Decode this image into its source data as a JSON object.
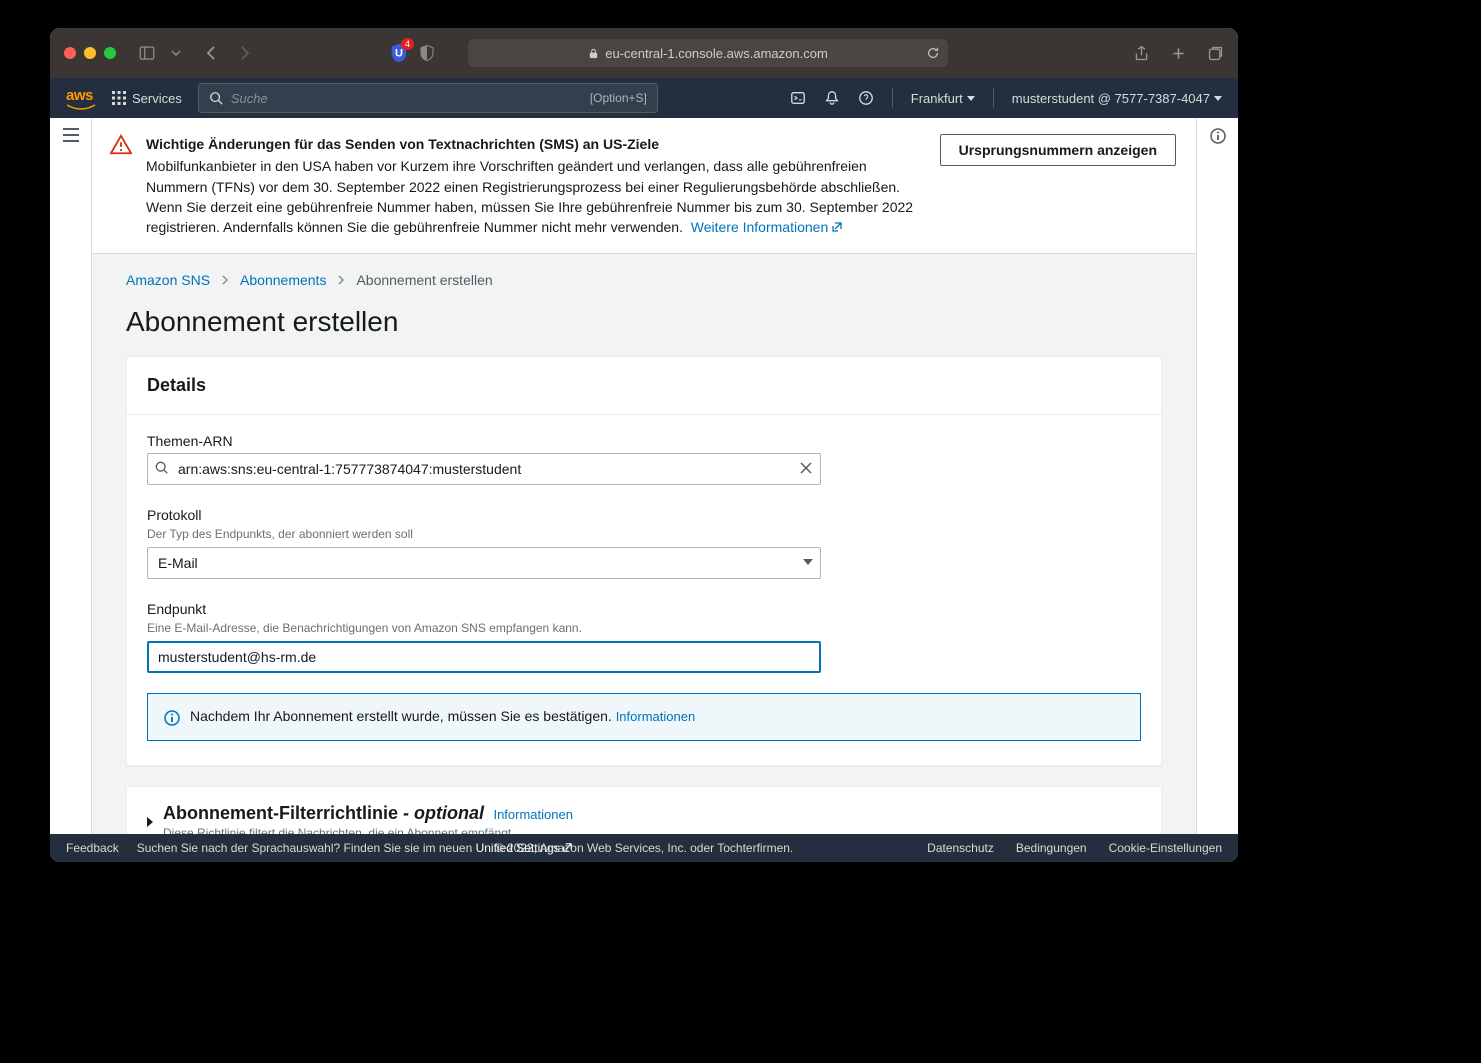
{
  "browser": {
    "url": "eu-central-1.console.aws.amazon.com",
    "ublock_badge": "4"
  },
  "aws_nav": {
    "services": "Services",
    "search_placeholder": "Suche",
    "search_shortcut": "[Option+S]",
    "region": "Frankfurt",
    "account": "musterstudent @ 7577-7387-4047"
  },
  "alert": {
    "title": "Wichtige Änderungen für das Senden von Textnachrichten (SMS) an US-Ziele",
    "body": "Mobilfunkanbieter in den USA haben vor Kurzem ihre Vorschriften geändert und verlangen, dass alle gebührenfreien Nummern (TFNs) vor dem 30. September 2022 einen Registrierungsprozess bei einer Regulierungsbehörde abschließen. Wenn Sie derzeit eine gebührenfreie Nummer haben, müssen Sie Ihre gebührenfreie Nummer bis zum 30. September 2022 registrieren. Andernfalls können Sie die gebührenfreie Nummer nicht mehr verwenden.",
    "more": "Weitere Informationen",
    "button": "Ursprungsnummern anzeigen"
  },
  "breadcrumbs": {
    "a": "Amazon SNS",
    "b": "Abonnements",
    "c": "Abonnement erstellen"
  },
  "page_title": "Abonnement erstellen",
  "details": {
    "heading": "Details",
    "arn_label": "Themen-ARN",
    "arn_value": "arn:aws:sns:eu-central-1:757773874047:musterstudent",
    "protocol_label": "Protokoll",
    "protocol_hint": "Der Typ des Endpunkts, der abonniert werden soll",
    "protocol_value": "E-Mail",
    "endpoint_label": "Endpunkt",
    "endpoint_hint": "Eine E-Mail-Adresse, die Benachrichtigungen von Amazon SNS empfangen kann.",
    "endpoint_value": "musterstudent@hs-rm.de",
    "info_text": "Nachdem Ihr Abonnement erstellt wurde, müssen Sie es bestätigen.",
    "info_link": "Informationen"
  },
  "filter_panel": {
    "title": "Abonnement-Filterrichtlinie",
    "optional": " - optional",
    "info_link": "Informationen",
    "sub": "Diese Richtlinie filtert die Nachrichten, die ein Abonnent empfängt."
  },
  "footer": {
    "feedback": "Feedback",
    "lang_q": "Suchen Sie nach der Sprachauswahl? Finden Sie sie im neuen ",
    "unified": "Unified Settings",
    "copyright": "© 2022, Amazon Web Services, Inc. oder Tochterfirmen.",
    "privacy": "Datenschutz",
    "terms": "Bedingungen",
    "cookies": "Cookie-Einstellungen"
  }
}
